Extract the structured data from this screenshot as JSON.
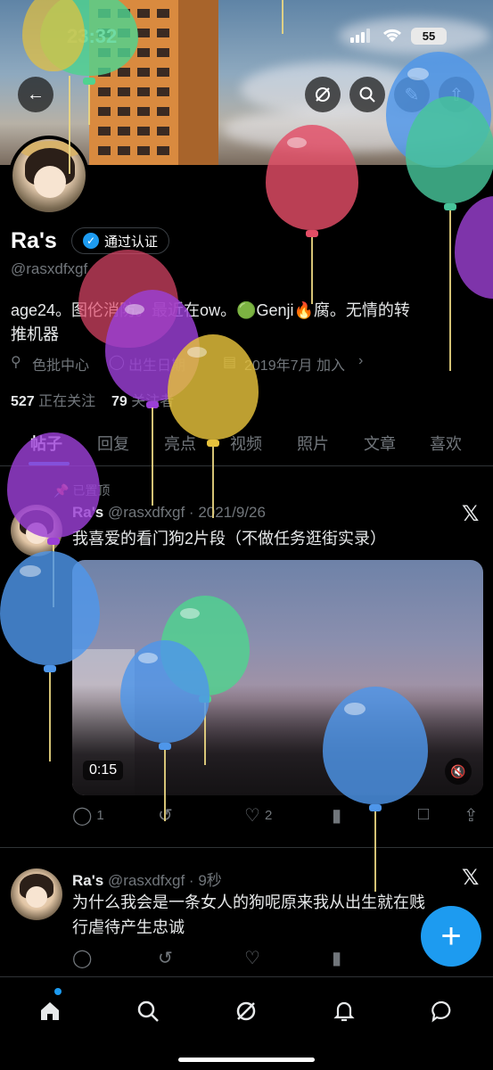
{
  "status_bar": {
    "time": "23:32",
    "battery": "55"
  },
  "profile": {
    "name": "Ra's",
    "verified_label": "通过认证",
    "handle": "@rasxdfxgf",
    "bio_line1": "age24。图伦消防。最近在ow。🟢Genji🔥腐。无情的转",
    "bio_line2": "推机器",
    "location": "色批中心",
    "birthday": "出生日期",
    "joined": "2019年7月 加入",
    "following_count": "527",
    "following_label": "正在关注",
    "followers_count": "79",
    "followers_label": "关注者"
  },
  "tabs": [
    "帖子",
    "回复",
    "亮点",
    "视频",
    "照片",
    "文章",
    "喜欢"
  ],
  "tweets": [
    {
      "pinned_label": "已置顶",
      "name": "Ra's",
      "handle": "@rasxdfxgf",
      "time": "2021/9/26",
      "text": "我喜爱的看门狗2片段（不做任务逛街实录）",
      "video_duration": "0:15",
      "replies": "1",
      "likes": "2"
    },
    {
      "name": "Ra's",
      "handle": "@rasxdfxgf",
      "time": "9秒",
      "text_line1": "为什么我会是一条女人的狗呢原来我从出生就在贱",
      "text_line2": "行虐待产生忠诚"
    }
  ],
  "icons": {
    "back": "back-arrow-icon",
    "grok": "grok-icon",
    "search": "search-icon",
    "edit": "edit-icon",
    "share": "share-icon",
    "x_logo": "x-logo-icon",
    "fab": "plus-icon"
  },
  "colors": {
    "accent": "#1d9bf0",
    "background": "#000000",
    "muted": "#71767b"
  }
}
